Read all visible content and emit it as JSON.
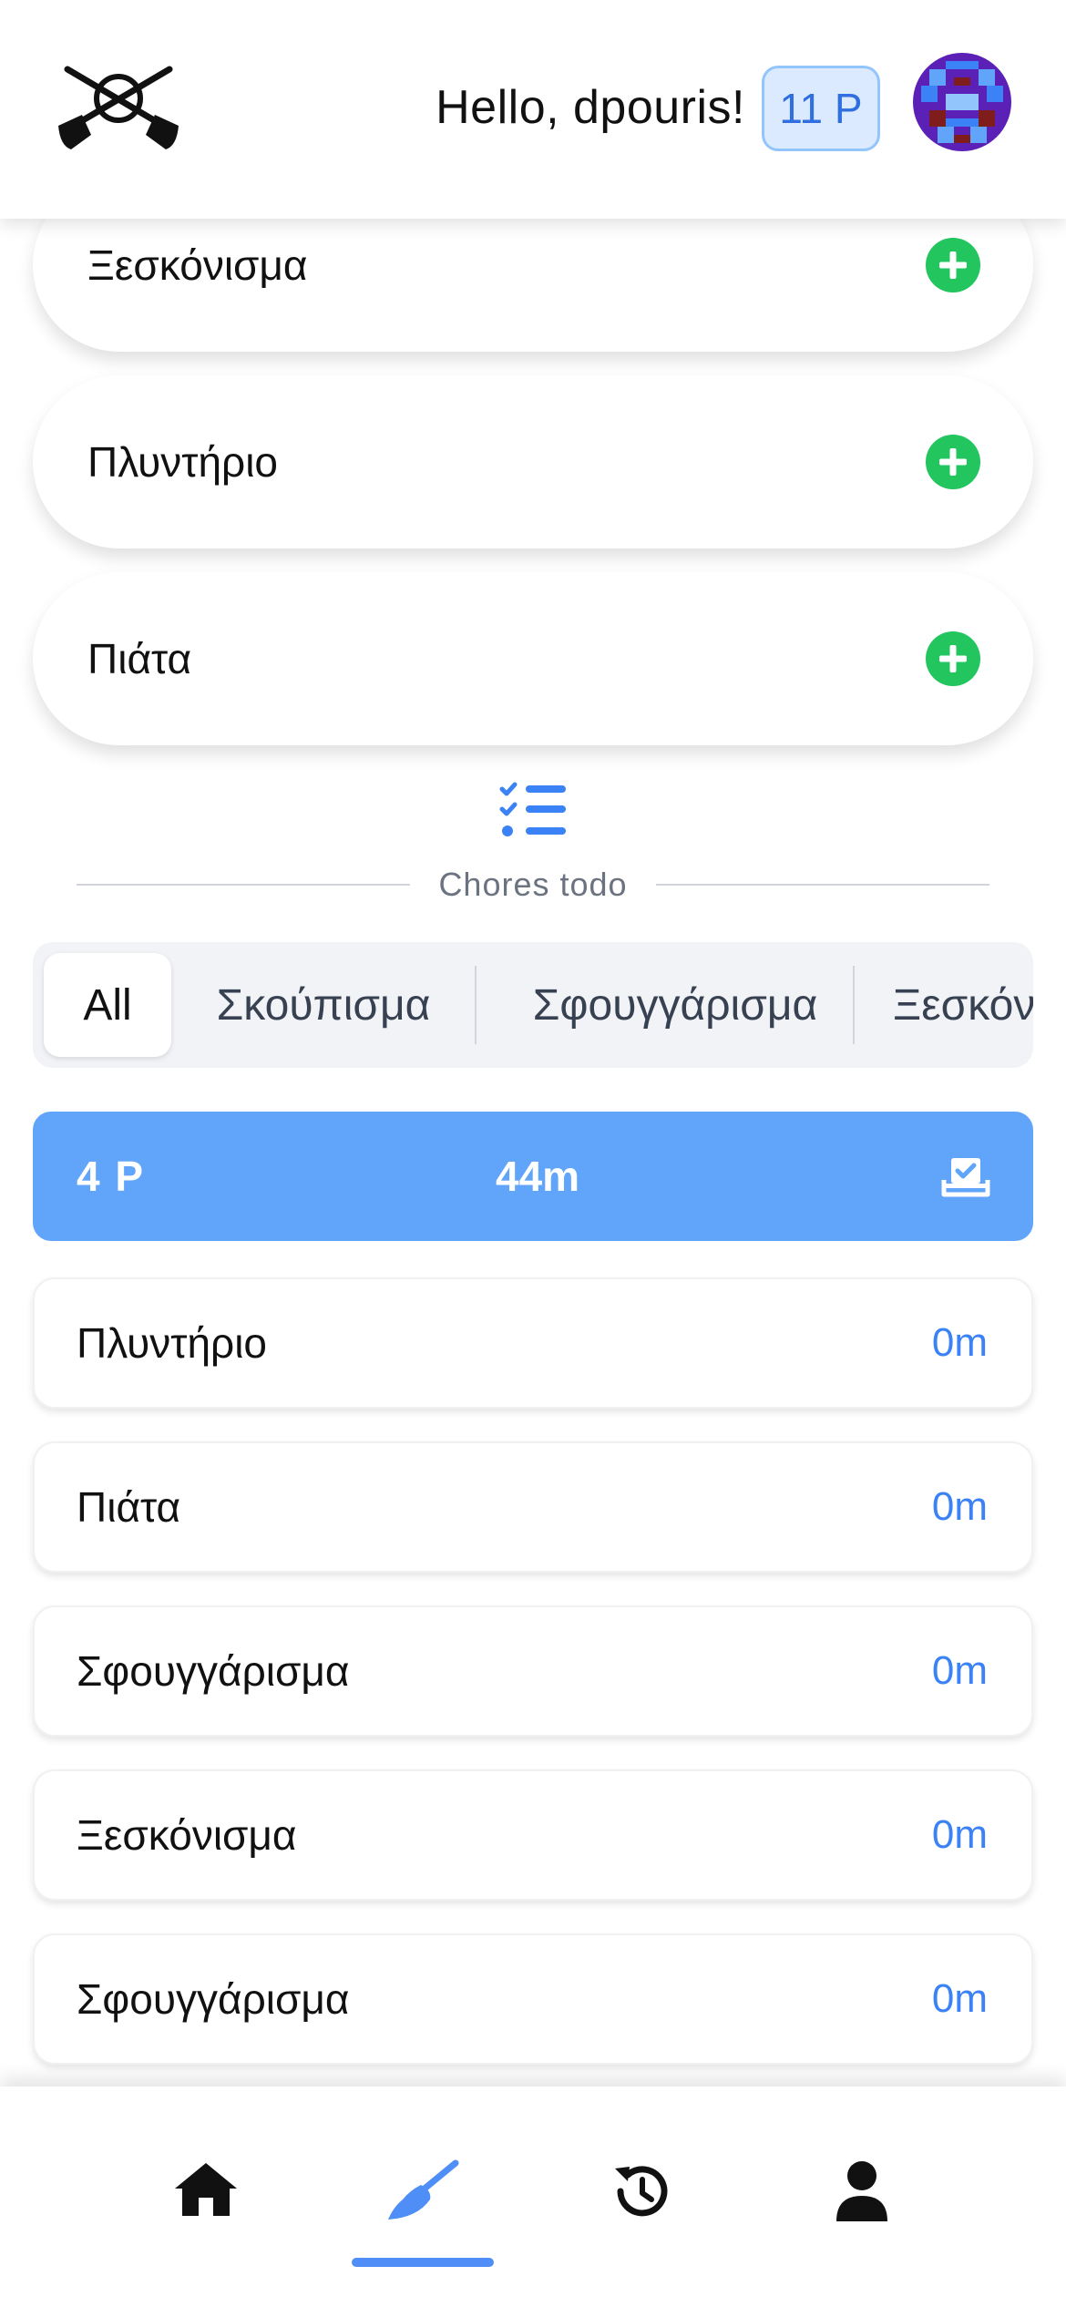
{
  "header": {
    "greeting": "Hello, dpouris!",
    "points_badge": "11 P"
  },
  "chores": [
    {
      "name": "Ξεσκόνισμα"
    },
    {
      "name": "Πλυντήριο"
    },
    {
      "name": "Πιάτα"
    }
  ],
  "section": {
    "label": "Chores todo"
  },
  "tabs": [
    {
      "label": "All",
      "active": true
    },
    {
      "label": "Σκούπισμα",
      "active": false
    },
    {
      "label": "Σφουγγάρισμα",
      "active": false
    },
    {
      "label": "Ξεσκόν",
      "active": false
    }
  ],
  "summary": {
    "points": "4 P",
    "time": "44m"
  },
  "todos": [
    {
      "name": "Πλυντήριο",
      "elapsed": "0m"
    },
    {
      "name": "Πιάτα",
      "elapsed": "0m"
    },
    {
      "name": "Σφουγγάρισμα",
      "elapsed": "0m"
    },
    {
      "name": "Ξεσκόνισμα",
      "elapsed": "0m"
    },
    {
      "name": "Σφουγγάρισμα",
      "elapsed": "0m"
    }
  ],
  "nav": {
    "items": [
      {
        "icon": "home-icon",
        "active": false
      },
      {
        "icon": "broom-icon",
        "active": true
      },
      {
        "icon": "history-icon",
        "active": false
      },
      {
        "icon": "user-icon",
        "active": false
      }
    ]
  },
  "colors": {
    "accent": "#60a5fa",
    "add_button": "#22c55e",
    "elapsed_text": "#3b82f6",
    "badge_bg": "#dbeafe"
  }
}
